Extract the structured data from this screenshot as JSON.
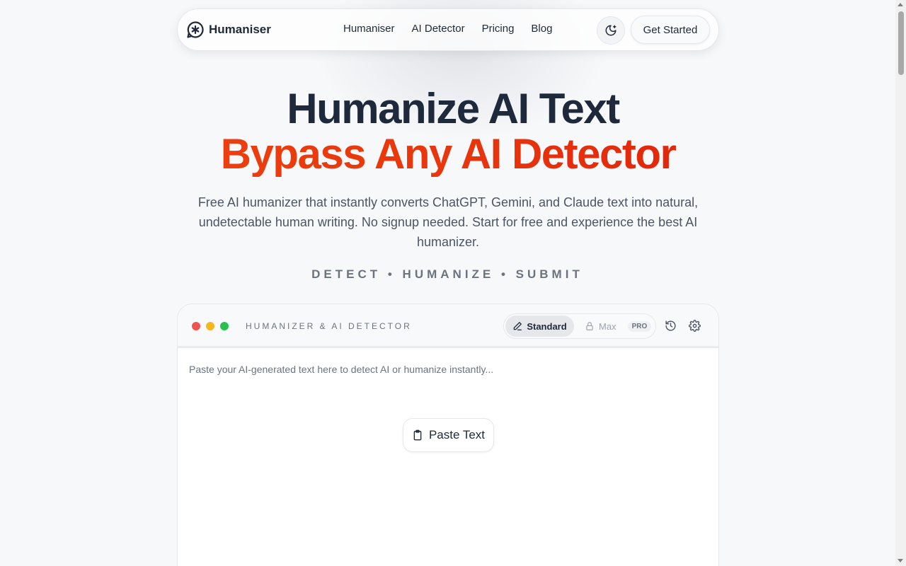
{
  "navbar": {
    "brand_name": "Humaniser",
    "logo_icon": "asterisk-chat-icon",
    "links": [
      "Humaniser",
      "AI Detector",
      "Pricing",
      "Blog"
    ],
    "theme_icon": "moon-icon",
    "cta_label": "Get Started"
  },
  "hero": {
    "title": "Humanize AI Text",
    "subtitle": "Bypass Any AI Detector",
    "description": "Free AI humanizer that instantly converts ChatGPT, Gemini, and Claude text into natural, undetectable human writing. No signup needed. Start for free and experience the best AI humanizer.",
    "tagline": "DETECT • HUMANIZE • SUBMIT"
  },
  "tool": {
    "title": "HUMANIZER & AI DETECTOR",
    "modes": {
      "standard_label": "Standard",
      "standard_icon": "pencil-icon",
      "max_label": "Max",
      "max_icon": "lock-icon",
      "pro_badge": "PRO"
    },
    "history_icon": "history-icon",
    "settings_icon": "gear-icon",
    "placeholder": "Paste your AI-generated text here to detect AI or humanize instantly...",
    "paste_label": "Paste Text",
    "paste_icon": "clipboard-icon"
  },
  "colors": {
    "accent_start": "#f0460f",
    "accent_end": "#d91a0a",
    "dot_red": "#ef5350",
    "dot_yellow": "#f5b81c",
    "dot_green": "#27c24c"
  }
}
